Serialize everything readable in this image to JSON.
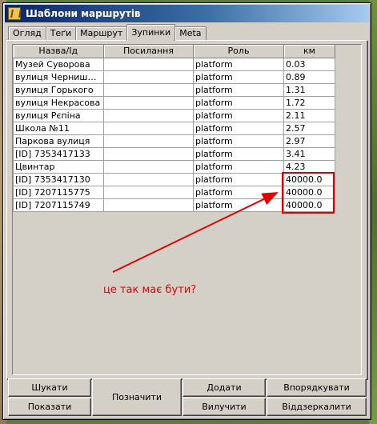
{
  "window": {
    "title": "Шаблони маршрутів"
  },
  "tabs": [
    {
      "label": "Огляд"
    },
    {
      "label": "Теґи"
    },
    {
      "label": "Маршрут"
    },
    {
      "label": "Зупинки"
    },
    {
      "label": "Meta"
    }
  ],
  "active_tab": "Зупинки",
  "table": {
    "headers": [
      "Назва/Ід",
      "Посилання",
      "Роль",
      "км"
    ],
    "rows": [
      {
        "name": "Музей Суворова",
        "link": "",
        "role": "platform",
        "km": "0.03"
      },
      {
        "name": "вулиця Чернишевського",
        "link": "",
        "role": "platform",
        "km": "0.89"
      },
      {
        "name": "вулиця Горького",
        "link": "",
        "role": "platform",
        "km": "1.31"
      },
      {
        "name": "вулиця Некрасова",
        "link": "",
        "role": "platform",
        "km": "1.72"
      },
      {
        "name": "вулиця Рєпіна",
        "link": "",
        "role": "platform",
        "km": "2.11"
      },
      {
        "name": "Школа №11",
        "link": "",
        "role": "platform",
        "km": "2.57"
      },
      {
        "name": "Паркова вулиця",
        "link": "",
        "role": "platform",
        "km": "2.97"
      },
      {
        "name": "[ID] 7353417133",
        "link": "",
        "role": "platform",
        "km": "3.41"
      },
      {
        "name": "Цвинтар",
        "link": "",
        "role": "platform",
        "km": "4.23"
      },
      {
        "name": "[ID] 7353417130",
        "link": "",
        "role": "platform",
        "km": "40000.0"
      },
      {
        "name": "[ID] 7207115775",
        "link": "",
        "role": "platform",
        "km": "40000.0"
      },
      {
        "name": "[ID] 7207115749",
        "link": "",
        "role": "platform",
        "km": "40000.0"
      }
    ]
  },
  "annotation": {
    "text": "це так має бути?",
    "color": "#e00000"
  },
  "buttons": {
    "search": "Шукати",
    "show": "Показати",
    "mark": "Позначити",
    "add": "Додати",
    "remove": "Вилучити",
    "sort": "Впорядкувати",
    "mirror": "Віддзеркалити"
  },
  "colors": {
    "titlebar_start": "#0a246a",
    "titlebar_end": "#a6caf0",
    "window_bg": "#d4d0c8",
    "highlight": "#e00000"
  }
}
